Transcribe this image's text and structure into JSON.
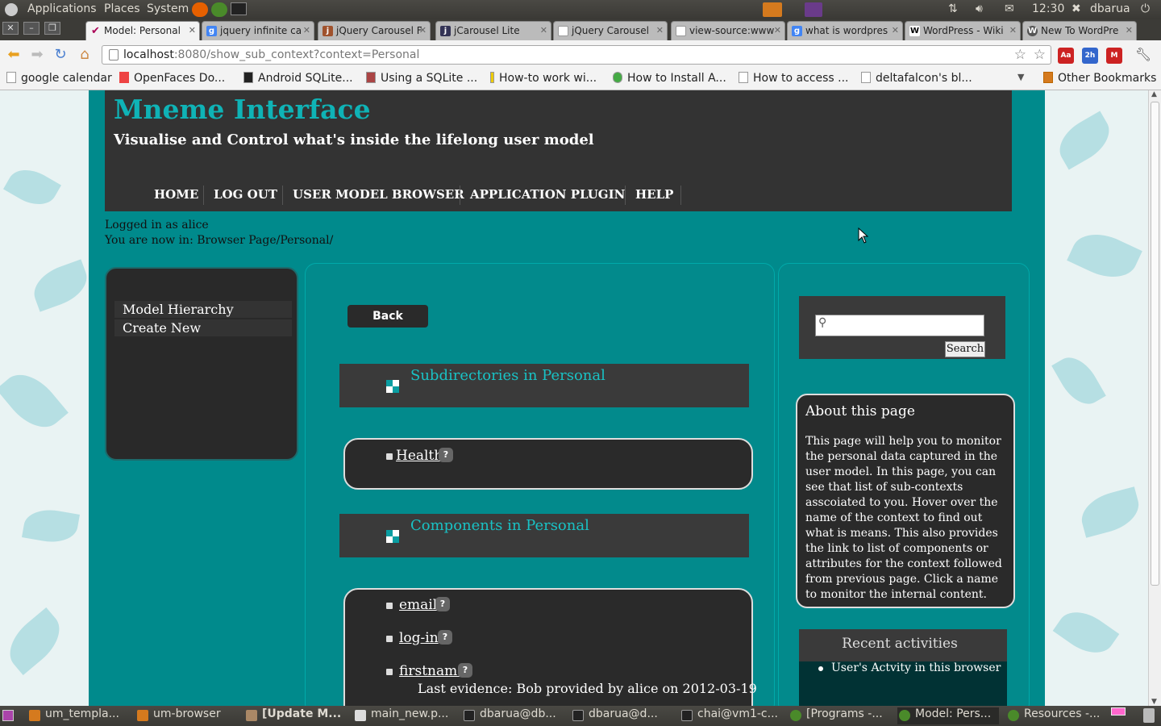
{
  "top_panel": {
    "menus": [
      "Applications",
      "Places",
      "System"
    ],
    "clock": "12:30",
    "user": "dbarua"
  },
  "tabs": [
    {
      "label": "Model: Personal",
      "active": true,
      "icon": "model-icon"
    },
    {
      "label": "jquery infinite ca",
      "icon": "google-icon"
    },
    {
      "label": "jQuery Carousel F",
      "icon": "jquery-icon"
    },
    {
      "label": "jCarousel Lite",
      "icon": "jcarousel-icon"
    },
    {
      "label": "jQuery Carousel",
      "icon": "page-icon"
    },
    {
      "label": "view-source:www",
      "icon": "page-icon"
    },
    {
      "label": "what is wordpres",
      "icon": "google-icon"
    },
    {
      "label": "WordPress - Wiki",
      "icon": "wikipedia-icon"
    },
    {
      "label": "New To WordPre",
      "icon": "wordpress-icon"
    }
  ],
  "toolbar": {
    "url_host": "localhost",
    "url_path": ":8080/show_sub_context?context=Personal"
  },
  "bookmarks": [
    "google calendar",
    "OpenFaces Do...",
    "Android SQLite...",
    "Using a SQLite ...",
    "How-to work wi...",
    "How to Install A...",
    "How to access ...",
    "deltafalcon's bl..."
  ],
  "other_bookmarks": "Other Bookmarks",
  "site": {
    "title": "Mneme Interface",
    "tagline": "Visualise and Control what's inside the lifelong user model",
    "nav": [
      "HOME",
      "LOG OUT",
      "USER MODEL BROWSER",
      "APPLICATION PLUGIN",
      "HELP"
    ],
    "logged_in": "Logged in as alice",
    "location": "You are now in: Browser Page/Personal/"
  },
  "left_menu": [
    "Model Hierarchy",
    "Create New"
  ],
  "main": {
    "back_label": "Back",
    "subdir_heading": "Subdirectories in Personal",
    "subdirs": [
      "Health"
    ],
    "components_heading": "Components in Personal",
    "components": [
      "email",
      "log-in",
      "firstname"
    ],
    "evidence": "Last evidence: Bob provided by alice on 2012-03-19",
    "help_glyph": "?"
  },
  "sidebar": {
    "search_button": "Search",
    "about_title": "About this page",
    "about_text": "This page will help you to monitor the personal data captured in the user model. In this page, you can see that list of sub-contexts asscoiated to you. Hover over the name of the context to find out what is means. This also provides the link to list of components or attributes for the context followed from previous page. Click a name to monitor the internal content.",
    "recent_title": "Recent activities",
    "recent_item": "User's Actvity in this browser"
  },
  "taskbar": [
    "um_templa...",
    "um-browser",
    "[Update M...",
    "main_new.p...",
    "dbarua@db...",
    "dbarua@d...",
    "chai@vm1-c...",
    "[Programs -...",
    "Model: Pers...",
    "Resources -..."
  ],
  "colors": {
    "accent": "#0fb3b6",
    "page_bg": "#008a8c",
    "header_bg": "#333333"
  }
}
